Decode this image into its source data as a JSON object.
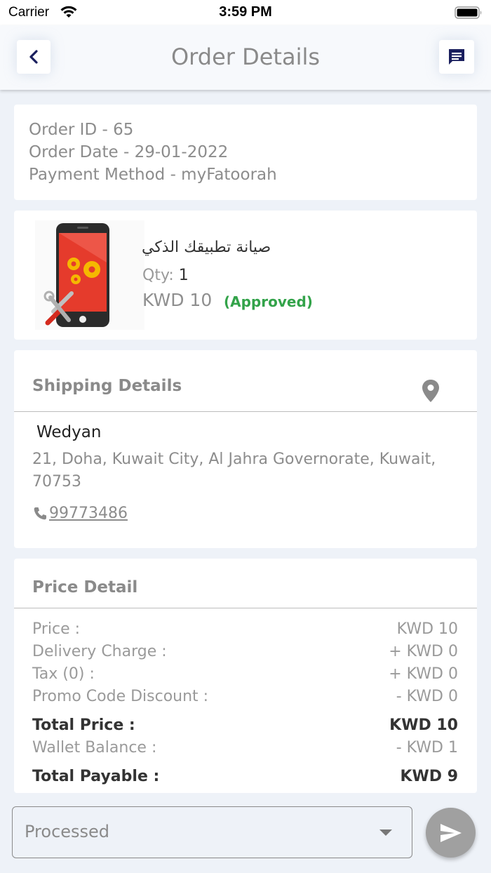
{
  "status_bar": {
    "carrier": "Carrier",
    "time": "3:59 PM"
  },
  "header": {
    "title": "Order Details",
    "back_icon": "chevron-left-icon",
    "chat_icon": "message-icon"
  },
  "order": {
    "id_line": "Order ID - 65",
    "date_line": "Order Date - 29-01-2022",
    "payment_line": "Payment Method - myFatoorah"
  },
  "product": {
    "name": "صيانة تطبيقك الذكي",
    "qty_label": "Qty:",
    "qty_value": "1",
    "price": "KWD 10",
    "status": "(Approved)",
    "status_color": "#33a34a"
  },
  "shipping": {
    "title": "Shipping Details",
    "name": "Wedyan",
    "address": "21, Doha, Kuwait City, Al Jahra Governorate, Kuwait, 70753",
    "phone": " 99773486"
  },
  "price_detail": {
    "title": "Price Detail",
    "rows": [
      {
        "label": "Price :",
        "value": "KWD 10"
      },
      {
        "label": "Delivery Charge :",
        "value": "+ KWD 0"
      },
      {
        "label": "Tax (0) :",
        "value": "+ KWD 0"
      },
      {
        "label": "Promo Code Discount :",
        "value": "- KWD 0"
      },
      {
        "label": "Total Price :",
        "value": "KWD 10"
      },
      {
        "label": "Wallet Balance :",
        "value": "- KWD 1"
      },
      {
        "label": "Total Payable :",
        "value": "KWD 9"
      }
    ]
  },
  "bottom": {
    "status_value": "Processed",
    "send_icon": "send-icon"
  },
  "colors": {
    "accent": "#1a1f5e",
    "background": "#eef2f8",
    "approved": "#33a34a"
  }
}
